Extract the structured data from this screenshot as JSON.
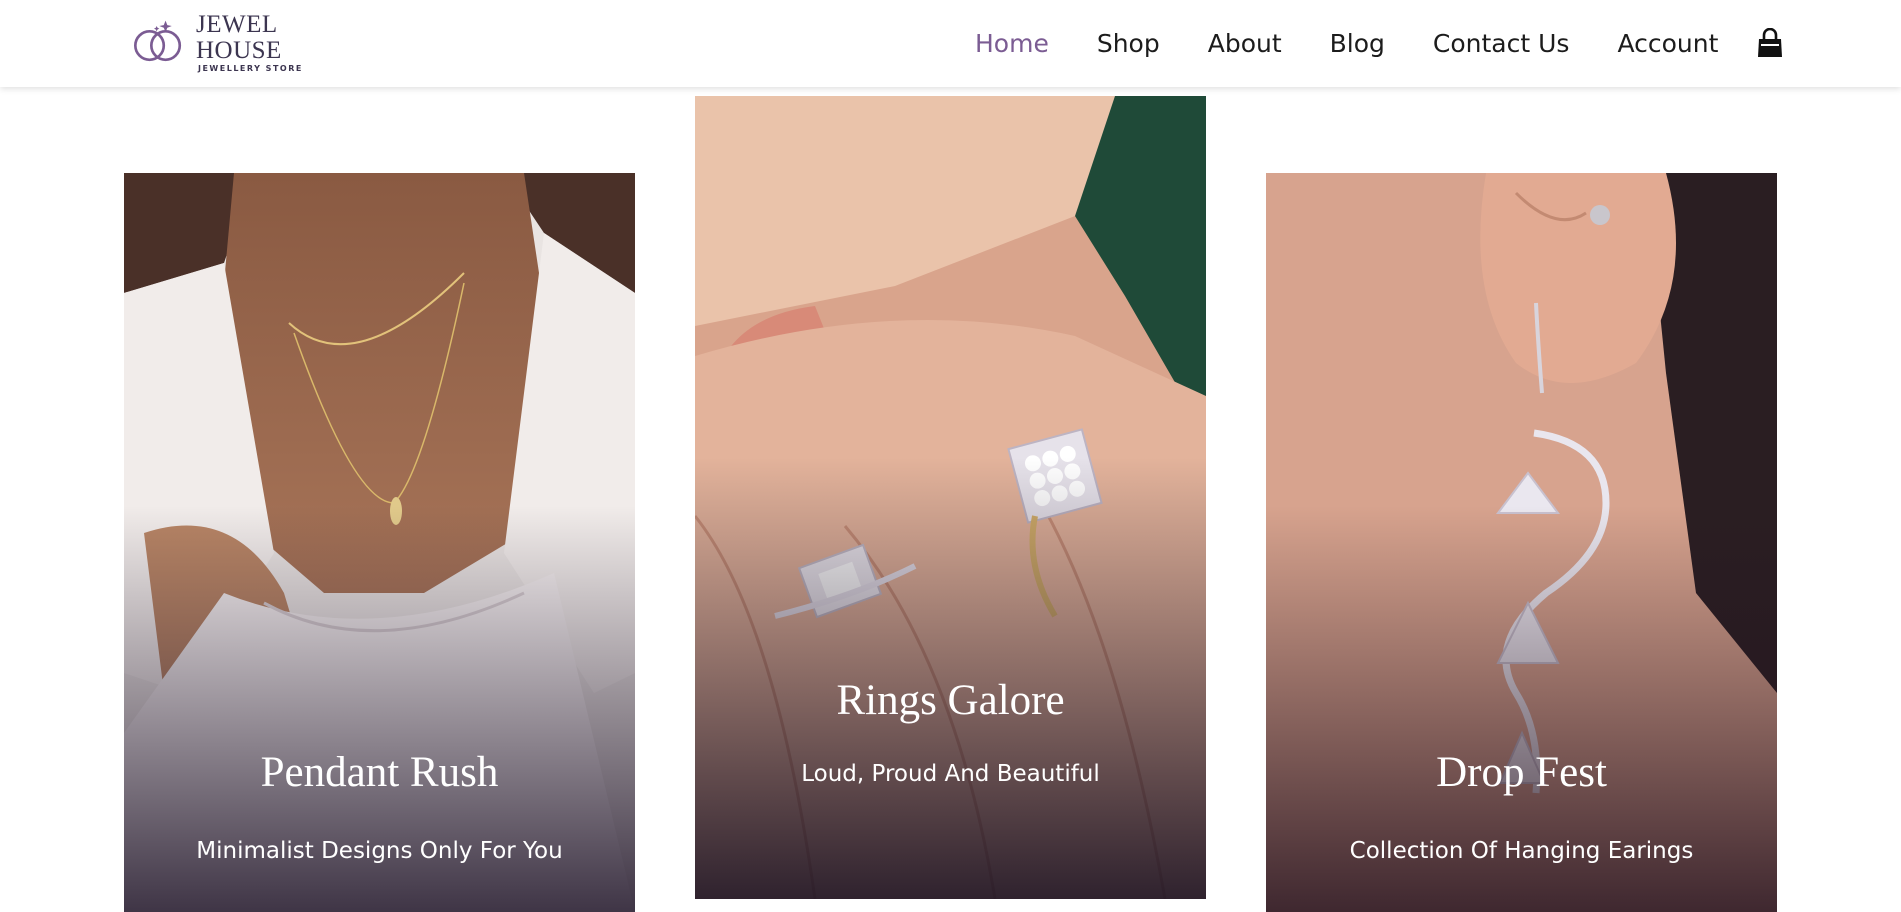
{
  "brand": {
    "name": "JEWEL HOUSE",
    "tagline": "JEWELLERY STORE",
    "logo_icon": "interlocked-rings-logo",
    "accent_color": "#7b5c93"
  },
  "nav": {
    "items": [
      {
        "label": "Home",
        "active": true
      },
      {
        "label": "Shop",
        "active": false
      },
      {
        "label": "About",
        "active": false
      },
      {
        "label": "Blog",
        "active": false
      },
      {
        "label": "Contact Us",
        "active": false
      },
      {
        "label": "Account",
        "active": false
      }
    ],
    "cart_icon": "shopping-bag-icon"
  },
  "cards": [
    {
      "title": "Pendant Rush",
      "subtitle": "Minimalist Designs Only For You",
      "image": "woman-wearing-gold-pendant-necklace"
    },
    {
      "title": "Rings Galore",
      "subtitle": "Loud, Proud And Beautiful",
      "image": "hand-wearing-diamond-rings"
    },
    {
      "title": "Drop Fest",
      "subtitle": "Collection Of Hanging Earings",
      "image": "ear-with-long-diamond-drop-earring"
    }
  ]
}
